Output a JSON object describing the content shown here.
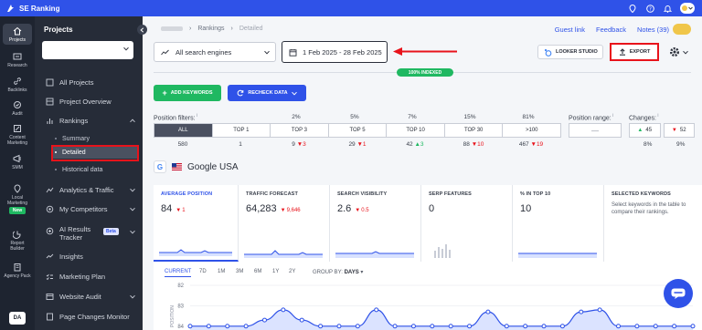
{
  "app": {
    "brand": "SE Ranking"
  },
  "rail": [
    {
      "key": "projects",
      "label": "Projects",
      "icon": "home-icon",
      "active": true
    },
    {
      "key": "research",
      "label": "Research",
      "icon": "research-icon"
    },
    {
      "key": "backlinks",
      "label": "Backlinks",
      "icon": "link-icon"
    },
    {
      "key": "audit",
      "label": "Audit",
      "icon": "audit-icon"
    },
    {
      "key": "content",
      "label": "Content Marketing",
      "icon": "content-icon"
    },
    {
      "key": "smm",
      "label": "SMM",
      "icon": "smm-icon"
    },
    {
      "key": "local",
      "label": "Local Marketing",
      "icon": "location-icon",
      "badge": "New"
    },
    {
      "key": "report",
      "label": "Report Builder",
      "icon": "report-icon"
    },
    {
      "key": "agency",
      "label": "Agency Pack",
      "icon": "agency-icon"
    }
  ],
  "rail_user": "DA",
  "sidebar": {
    "title": "Projects",
    "items": [
      {
        "label": "All Projects"
      },
      {
        "label": "Project Overview"
      },
      {
        "label": "Rankings"
      },
      {
        "label": "Analytics & Traffic"
      },
      {
        "label": "My Competitors"
      },
      {
        "label": "AI Results Tracker",
        "badge": "Beta"
      },
      {
        "label": "Insights"
      },
      {
        "label": "Marketing Plan"
      },
      {
        "label": "Website Audit"
      },
      {
        "label": "Page Changes Monitor"
      }
    ],
    "subitems": [
      {
        "label": "Summary"
      },
      {
        "label": "Detailed"
      },
      {
        "label": "Historical data"
      }
    ]
  },
  "breadcrumb": {
    "items": [
      "Rankings",
      "Detailed"
    ]
  },
  "toplinks": {
    "guest": "Guest link",
    "feedback": "Feedback",
    "notes": "Notes (39)"
  },
  "filters": {
    "engine": "All search engines",
    "date_range": "1 Feb 2025 - 28 Feb 2025",
    "indexed": "100% INDEXED",
    "looker": "LOOKER STUDIO",
    "export": "EXPORT"
  },
  "actions": {
    "add_keywords": "ADD KEYWORDS",
    "recheck": "RECHECK DATA"
  },
  "position_filters": {
    "label": "Position filters:",
    "cells": [
      "ALL",
      "TOP 1",
      "TOP 3",
      "TOP 5",
      "TOP 10",
      "TOP 30",
      ">100"
    ],
    "percents": [
      "2%",
      "5%",
      "7%",
      "15%",
      "81%"
    ],
    "counts": [
      {
        "value": "580"
      },
      {
        "value": "1"
      },
      {
        "value": "9",
        "change": "3",
        "dir": "down"
      },
      {
        "value": "29",
        "change": "1",
        "dir": "down"
      },
      {
        "value": "42",
        "change": "3",
        "dir": "up"
      },
      {
        "value": "88",
        "change": "10",
        "dir": "down"
      },
      {
        "value": "467",
        "change": "19",
        "dir": "down"
      }
    ]
  },
  "position_range": {
    "label": "Position range:",
    "value": "—"
  },
  "changes": {
    "label": "Changes:",
    "up": "45",
    "down": "52",
    "up_pct": "8%",
    "down_pct": "9%"
  },
  "engine_header": {
    "label": "Google USA"
  },
  "metrics": [
    {
      "title": "AVERAGE POSITION",
      "value": "84",
      "delta": "1",
      "dir": "down"
    },
    {
      "title": "TRAFFIC FORECAST",
      "value": "64,283",
      "delta": "9,646",
      "dir": "down"
    },
    {
      "title": "SEARCH VISIBILITY",
      "value": "2.6",
      "delta": "0.5",
      "dir": "down"
    },
    {
      "title": "SERP FEATURES",
      "value": "0",
      "delta": "",
      "dir": ""
    },
    {
      "title": "% IN TOP 10",
      "value": "10",
      "delta": "",
      "dir": ""
    },
    {
      "title": "SELECTED KEYWORDS",
      "description": "Select keywords in the table to compare their rankings."
    }
  ],
  "chart_tabs": [
    "CURRENT",
    "7D",
    "1M",
    "3M",
    "6M",
    "1Y",
    "2Y"
  ],
  "group_by": {
    "label": "GROUP BY:",
    "value": "DAYS"
  },
  "chart_data": {
    "type": "line",
    "ylabel": "POSITION",
    "y_ticks": [
      "82",
      "83",
      "84"
    ],
    "ylim": [
      82,
      84.5
    ],
    "x": [
      1,
      2,
      3,
      4,
      5,
      6,
      7,
      8,
      9,
      10,
      11,
      12,
      13,
      14,
      15,
      16,
      17,
      18,
      19,
      20,
      21,
      22,
      23,
      24,
      25,
      26,
      27,
      28
    ],
    "series": [
      {
        "values": [
          84,
          84,
          84,
          84,
          83.7,
          83.2,
          83.7,
          84,
          84,
          84,
          83.2,
          84,
          84,
          84,
          84,
          84,
          83.3,
          84,
          84,
          84,
          84,
          83.3,
          83.2,
          84,
          84,
          84,
          84,
          84
        ]
      }
    ]
  },
  "colors": {
    "accent": "#2f52e8",
    "green": "#1fb861",
    "red": "#e8131b",
    "sidebar": "#262c38"
  }
}
